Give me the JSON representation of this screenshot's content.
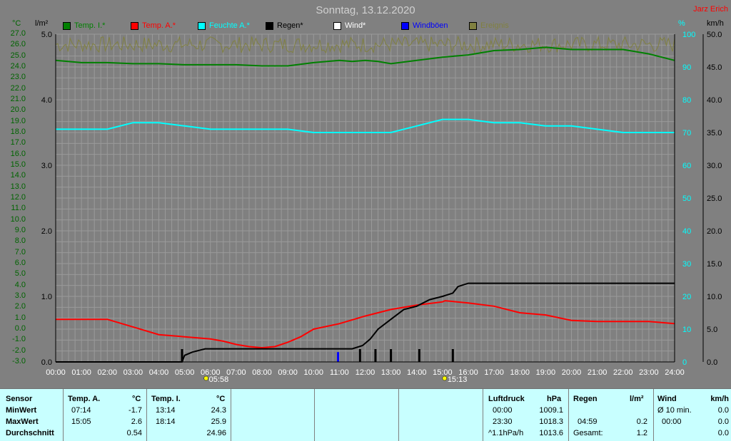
{
  "title": "Sonntag, 13.12.2020",
  "author": "Jarz Erich",
  "unit_labels": {
    "temp": "°C",
    "rain": "l/m²",
    "humidity": "%",
    "wind": "km/h"
  },
  "legend": [
    {
      "label": "Temp. I.*",
      "color": "#008000"
    },
    {
      "label": "Temp. A.*",
      "color": "#ff0000"
    },
    {
      "label": "Feuchte A.*",
      "color": "#00ffff"
    },
    {
      "label": "Regen*",
      "color": "#000000"
    },
    {
      "label": "Wind*",
      "color": "#ffffff"
    },
    {
      "label": "Windböen",
      "color": "#0000ff"
    },
    {
      "label": "Ereignis",
      "color": "#808040"
    }
  ],
  "sun_events": [
    {
      "label": "05:58",
      "hour": 5.97
    },
    {
      "label": "15:13",
      "hour": 15.22
    }
  ],
  "chart_data": {
    "type": "line",
    "title": "Sonntag, 13.12.2020",
    "xlabel": "",
    "x_ticks": [
      "00:00",
      "01:00",
      "02:00",
      "03:00",
      "04:00",
      "05:00",
      "06:00",
      "07:00",
      "08:00",
      "09:00",
      "10:00",
      "11:00",
      "12:00",
      "13:00",
      "14:00",
      "15:00",
      "16:00",
      "17:00",
      "18:00",
      "19:00",
      "20:00",
      "21:00",
      "22:00",
      "23:00",
      "24:00"
    ],
    "xlim": [
      0,
      24
    ],
    "axes": {
      "temp": {
        "ylim": [
          -3,
          27
        ],
        "ticks": [
          "27.0",
          "26.0",
          "25.0",
          "24.0",
          "23.0",
          "22.0",
          "21.0",
          "20.0",
          "19.0",
          "18.0",
          "17.0",
          "16.0",
          "15.0",
          "14.0",
          "13.0",
          "12.0",
          "11.0",
          "10.0",
          "9.0",
          "8.0",
          "7.0",
          "6.0",
          "5.0",
          "4.0",
          "3.0",
          "2.0",
          "1.0",
          "0.0",
          "-1.0",
          "-2.0",
          "-3.0"
        ],
        "color": "#008000"
      },
      "rain": {
        "ylim": [
          0,
          5
        ],
        "ticks": [
          "5.0",
          "4.0",
          "3.0",
          "2.0",
          "1.0",
          "0.0"
        ],
        "color": "#000000"
      },
      "humidity": {
        "ylim": [
          0,
          100
        ],
        "ticks": [
          "100",
          "90",
          "80",
          "70",
          "60",
          "50",
          "40",
          "30",
          "20",
          "10",
          "0"
        ],
        "color": "#00ffff"
      },
      "wind": {
        "ylim": [
          0,
          50
        ],
        "ticks": [
          "50.0",
          "45.0",
          "40.0",
          "35.0",
          "30.0",
          "25.0",
          "20.0",
          "15.0",
          "10.0",
          "5.0",
          "0.0"
        ],
        "color": "#404040"
      }
    },
    "series": [
      {
        "name": "Temp. I.*",
        "axis": "temp",
        "color": "#008000",
        "x": [
          0,
          1,
          2,
          3,
          4,
          5,
          6,
          7,
          8,
          9,
          10,
          11,
          11.5,
          12,
          12.5,
          13,
          14,
          15,
          16,
          17,
          18,
          19,
          20,
          21,
          22,
          23,
          24
        ],
        "y": [
          24.6,
          24.4,
          24.4,
          24.3,
          24.3,
          24.2,
          24.2,
          24.2,
          24.1,
          24.1,
          24.4,
          24.6,
          24.5,
          24.6,
          24.5,
          24.3,
          24.6,
          24.9,
          25.1,
          25.5,
          25.6,
          25.8,
          25.6,
          25.6,
          25.6,
          25.2,
          24.6
        ]
      },
      {
        "name": "Temp. A.*",
        "axis": "temp",
        "color": "#ff0000",
        "x": [
          0,
          1,
          2,
          3,
          4,
          5,
          5.5,
          6,
          6.5,
          7,
          7.5,
          8,
          8.5,
          9,
          9.5,
          10,
          11,
          12,
          13,
          14,
          15,
          15.1,
          16,
          17,
          18,
          19,
          20,
          21,
          22,
          23,
          24
        ],
        "y": [
          0.9,
          0.9,
          0.9,
          0.2,
          -0.5,
          -0.7,
          -0.8,
          -0.9,
          -1.1,
          -1.4,
          -1.6,
          -1.7,
          -1.6,
          -1.2,
          -0.7,
          0.0,
          0.5,
          1.2,
          1.8,
          2.2,
          2.5,
          2.6,
          2.4,
          2.1,
          1.5,
          1.3,
          0.8,
          0.7,
          0.7,
          0.7,
          0.5
        ]
      },
      {
        "name": "Feuchte A.*",
        "axis": "humidity",
        "color": "#00ffff",
        "x": [
          0,
          1,
          2,
          3,
          4,
          5,
          6,
          7,
          8,
          9,
          10,
          11,
          12,
          13,
          14,
          15,
          16,
          17,
          18,
          19,
          20,
          21,
          22,
          23,
          24
        ],
        "y": [
          71,
          71,
          71,
          73,
          73,
          72,
          71,
          71,
          71,
          71,
          70,
          70,
          70,
          70,
          72,
          74,
          74,
          73,
          73,
          72,
          72,
          71,
          70,
          70,
          70
        ]
      },
      {
        "name": "Regen*",
        "axis": "rain",
        "color": "#000000",
        "x": [
          0,
          4.9,
          5.0,
          5.3,
          5.8,
          6.5,
          7,
          8,
          9,
          10,
          11,
          11.5,
          11.9,
          12.2,
          12.5,
          13,
          13.5,
          14,
          14.5,
          15,
          15.4,
          15.6,
          16,
          17,
          18,
          19,
          20,
          21,
          22,
          23,
          24
        ],
        "y": [
          0,
          0,
          0.1,
          0.15,
          0.2,
          0.2,
          0.2,
          0.2,
          0.2,
          0.2,
          0.2,
          0.2,
          0.25,
          0.35,
          0.5,
          0.65,
          0.8,
          0.85,
          0.95,
          1.0,
          1.05,
          1.15,
          1.2,
          1.2,
          1.2,
          1.2,
          1.2,
          1.2,
          1.2,
          1.2,
          1.2
        ]
      },
      {
        "name": "Windböen",
        "axis": "wind",
        "color": "#0000ff",
        "x": [
          10.95
        ],
        "y": [
          1.5
        ]
      }
    ],
    "rain_events": [
      4.9,
      11.8,
      12.4,
      13.0,
      14.1,
      15.4
    ],
    "event_noise_band": {
      "axis": "temp",
      "ylim": [
        25.3,
        26.8
      ]
    }
  },
  "stats": {
    "sensor": {
      "header": "Sensor",
      "rows": [
        "MinWert",
        "MaxWert",
        "Durchschnitt"
      ]
    },
    "temp_a": {
      "header": "Temp. A.",
      "unit": "°C",
      "rows": [
        {
          "time": "07:14",
          "value": "-1.7"
        },
        {
          "time": "15:05",
          "value": "2.6"
        },
        {
          "time": "",
          "value": "0.54"
        }
      ]
    },
    "temp_i": {
      "header": "Temp. I.",
      "unit": "°C",
      "rows": [
        {
          "time": "13:14",
          "value": "24.3"
        },
        {
          "time": "18:14",
          "value": "25.9"
        },
        {
          "time": "",
          "value": "24.96"
        }
      ]
    },
    "luftdruck": {
      "header": "Luftdruck",
      "unit": "hPa",
      "rows": [
        {
          "time": "00:00",
          "value": "1009.1"
        },
        {
          "time": "23:30",
          "value": "1018.3"
        },
        {
          "time": "^1.1hPa/h",
          "value": "1013.6"
        }
      ]
    },
    "regen": {
      "header": "Regen",
      "unit": "l/m²",
      "rows": [
        {
          "time": "",
          "value": ""
        },
        {
          "time": "04:59",
          "value": "0.2"
        },
        {
          "time": "Gesamt:",
          "value": "1.2"
        }
      ]
    },
    "wind": {
      "header": "Wind",
      "unit": "km/h",
      "rows": [
        {
          "time": "Ø 10 min.",
          "value": "0.0"
        },
        {
          "time": "00:00",
          "value": "0.0"
        },
        {
          "time": "",
          "value": "0.0"
        }
      ]
    }
  }
}
